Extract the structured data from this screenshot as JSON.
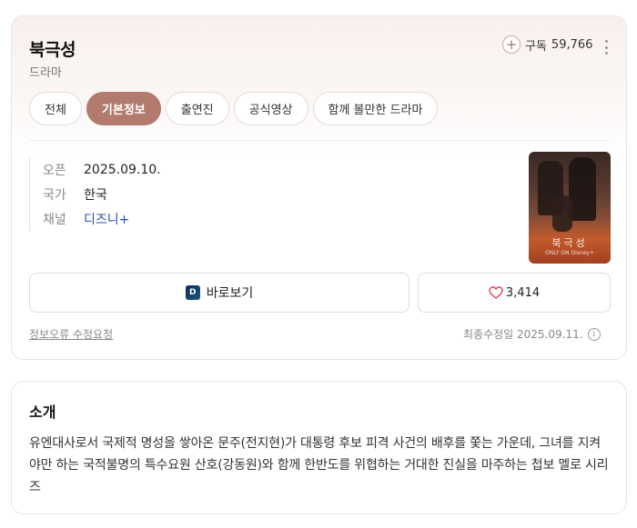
{
  "header": {
    "title": "북극성",
    "genre": "드라마",
    "subscribe_label": "구독",
    "subscribe_count": "59,766"
  },
  "tabs": [
    {
      "label": "전체"
    },
    {
      "label": "기본정보",
      "active": true
    },
    {
      "label": "출연진"
    },
    {
      "label": "공식영상"
    },
    {
      "label": "함께 볼만한 드라마"
    }
  ],
  "info": [
    {
      "key": "오픈",
      "value": "2025.09.10."
    },
    {
      "key": "국가",
      "value": "한국"
    },
    {
      "key": "채널",
      "value": "디즈니+"
    }
  ],
  "poster": {
    "title": "북극성",
    "brand": "ONLY ON Disney+"
  },
  "actions": {
    "watch_label": "바로보기",
    "like_count": "3,414"
  },
  "footer": {
    "report_link": "정보오류 수정요청",
    "updated_label": "최종수정일 2025.09.11."
  },
  "intro": {
    "heading": "소개",
    "text": "유엔대사로서 국제적 명성을 쌓아온 문주(전지현)가 대통령 후보 피격 사건의 배후를 쫓는 가운데, 그녀를 지켜야만 하는 국적불명의 특수요원 산호(강동원)와 함께 한반도를 위협하는 거대한 진실을 마주하는 첩보 멜로 시리즈"
  },
  "colors": {
    "accent": "#b27b6e",
    "link": "#2b4fb5",
    "heart": "#e0465a"
  }
}
